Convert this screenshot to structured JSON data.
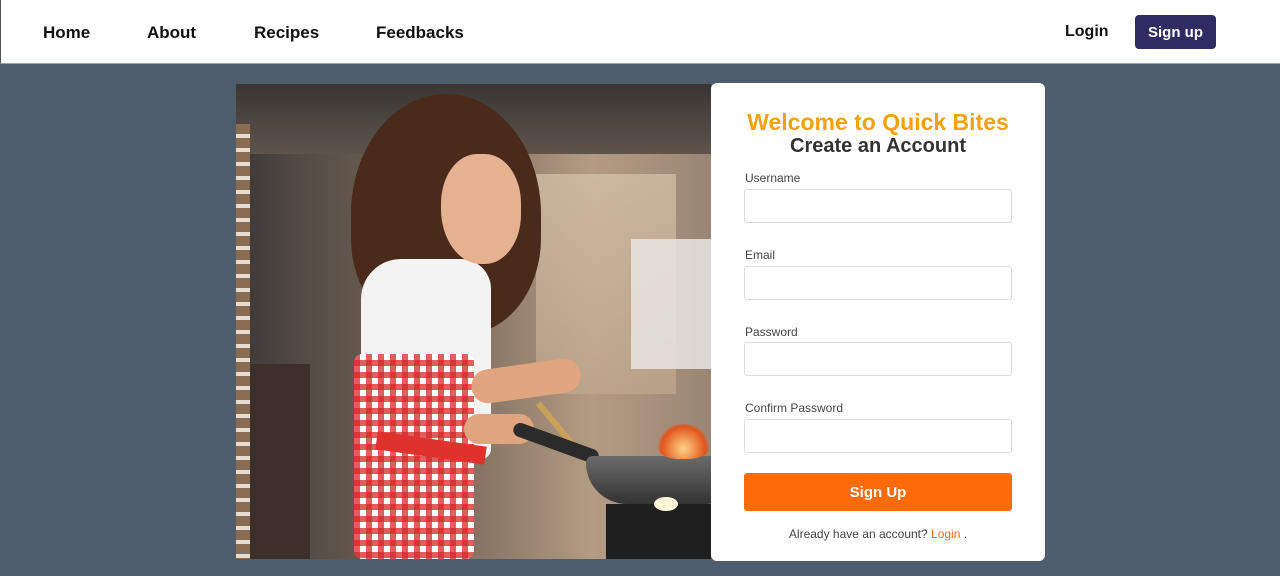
{
  "nav": {
    "links": [
      {
        "label": "Home"
      },
      {
        "label": "About"
      },
      {
        "label": "Recipes"
      },
      {
        "label": "Feedbacks"
      }
    ],
    "login_label": "Login",
    "signup_label": "Sign up"
  },
  "hero": {
    "description": "woman-cooking-in-kitchen"
  },
  "form": {
    "welcome": "Welcome to Quick Bites",
    "title": "Create an Account",
    "fields": [
      {
        "label": "Username",
        "value": ""
      },
      {
        "label": "Email",
        "value": ""
      },
      {
        "label": "Password",
        "value": ""
      },
      {
        "label": "Confirm Password",
        "value": ""
      }
    ],
    "submit_label": "Sign Up",
    "already_text": "Already have an account?",
    "login_link": "Login",
    "period": "."
  },
  "colors": {
    "background": "#4e5d6c",
    "accent_orange": "#ff6a0a",
    "welcome_gold": "#f5a00f",
    "signup_nav": "#2f2b63"
  }
}
